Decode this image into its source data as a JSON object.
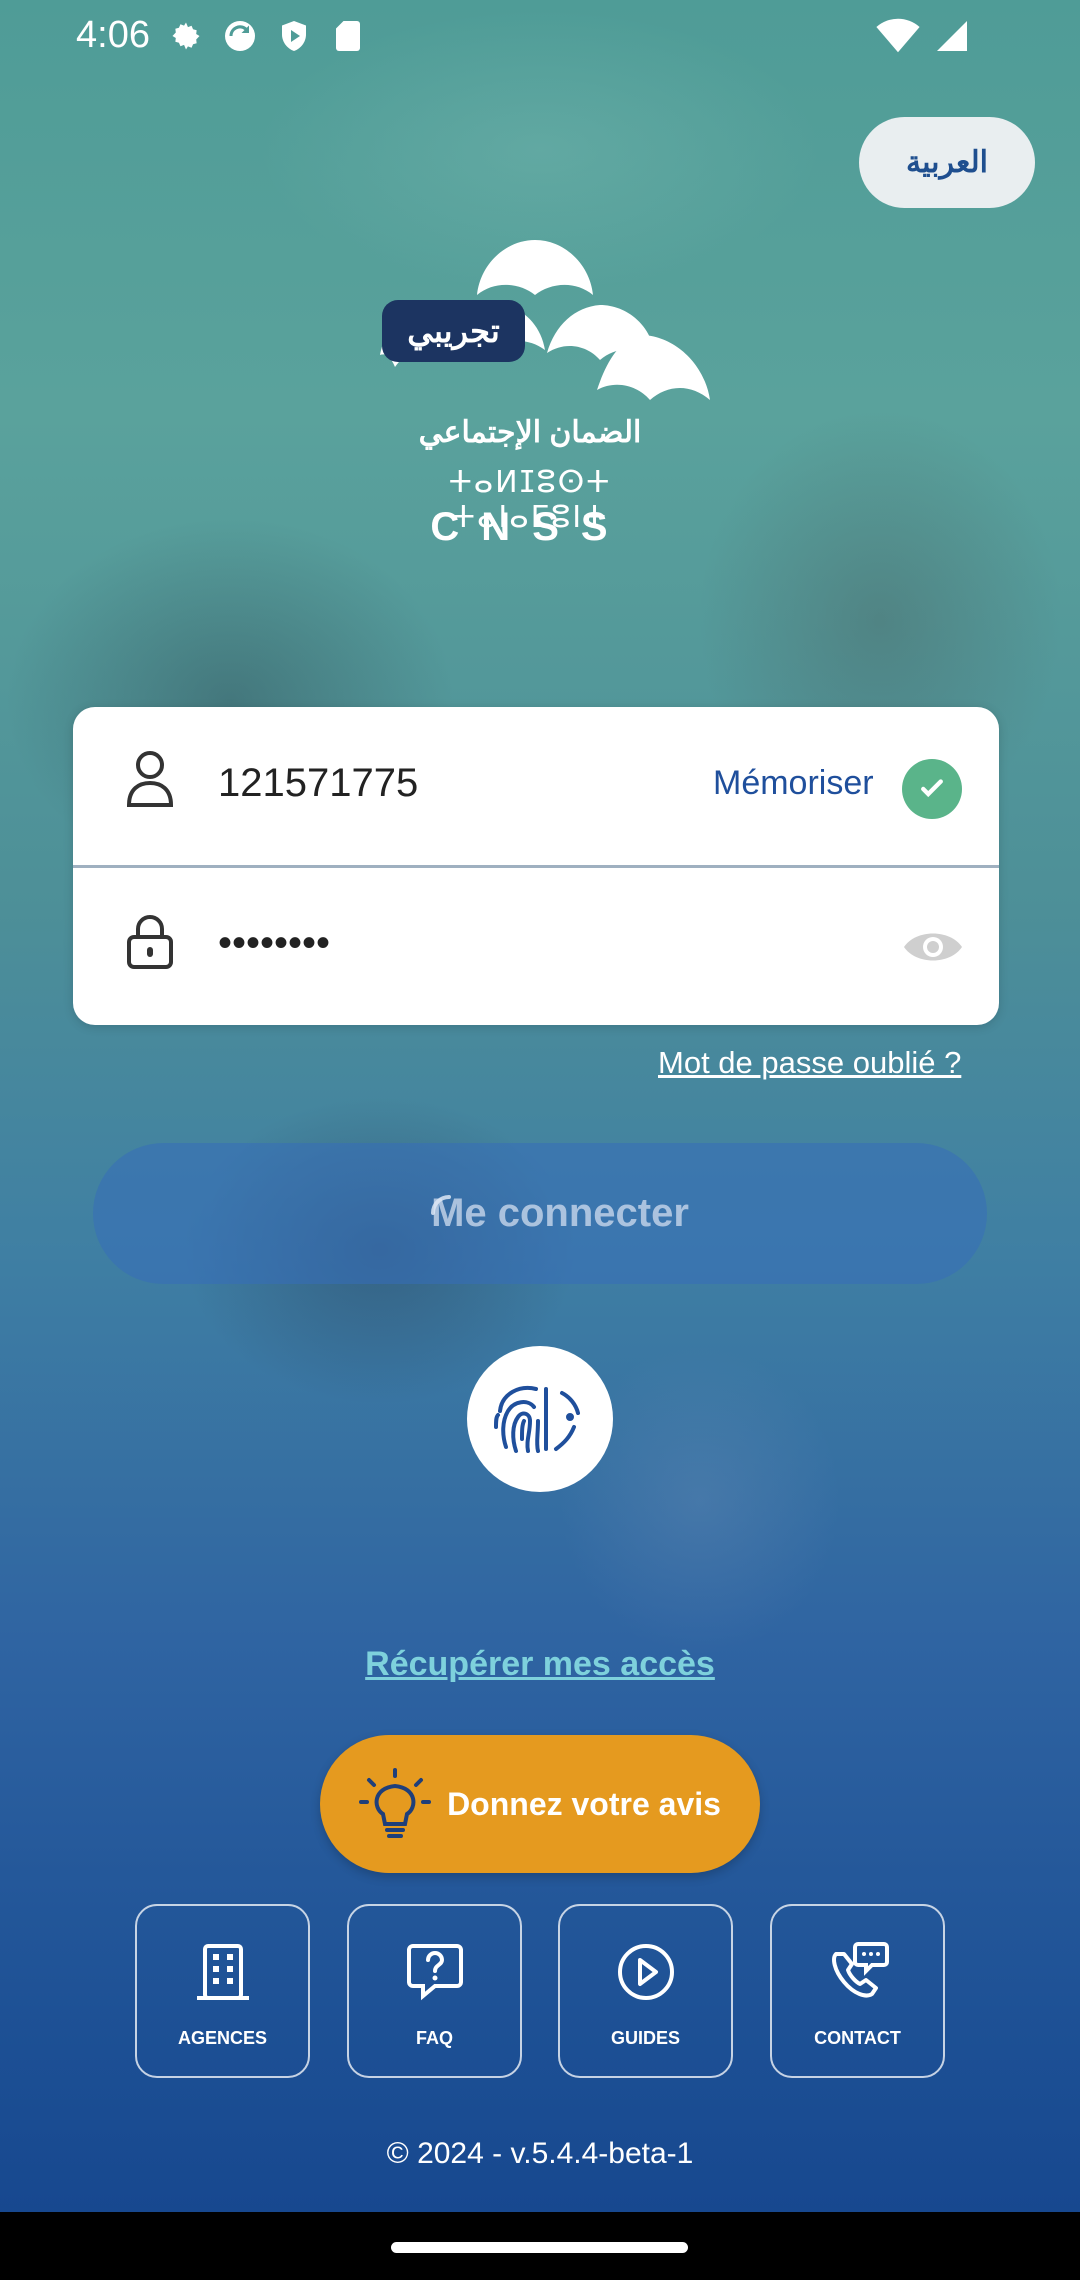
{
  "status_bar": {
    "time": "4:06"
  },
  "header": {
    "language_button": "العربية"
  },
  "logo": {
    "badge": "تجريبي",
    "arabic_name": "الضمان الإجتماعي",
    "tifinagh_name": "ⵜⴰⵍⵊⵓⵙⵜ ⵜⴰⵏⴰⵎⵓⵏⵜ",
    "acronym": "CNSS"
  },
  "login": {
    "username_value": "121571775",
    "remember_label": "Mémoriser",
    "password_value": "••••••••",
    "forgot_password": "Mot de passe oublié ?",
    "connect_button": "Me connecter"
  },
  "links": {
    "recover_access": "Récupérer mes accès",
    "feedback_button": "Donnez votre avis"
  },
  "quick_links": [
    {
      "label": "AGENCES",
      "icon": "building-icon"
    },
    {
      "label": "FAQ",
      "icon": "question-chat-icon"
    },
    {
      "label": "GUIDES",
      "icon": "play-icon"
    },
    {
      "label": "CONTACT",
      "icon": "phone-chat-icon"
    }
  ],
  "footer": {
    "version": "© 2024 - v.5.4.4-beta-1"
  },
  "colors": {
    "accent_blue": "#1f4f9c",
    "check_green": "#5ab48a",
    "feedback_orange": "#e59a1f",
    "recover_link": "#7ed1dc"
  }
}
